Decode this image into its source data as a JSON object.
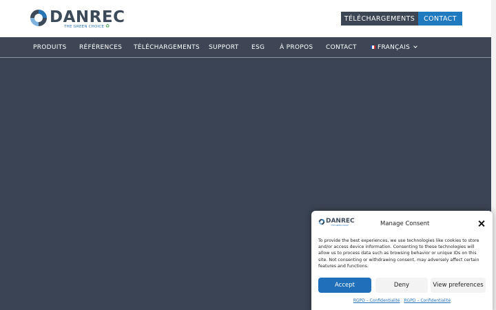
{
  "brand": {
    "name": "DANREC",
    "tagline": "THE GREEN CHOICE",
    "colors": {
      "dark": "#3c4a5a",
      "blue": "#1f7ac0",
      "green": "#3aa04a"
    }
  },
  "header": {
    "downloads_label": "TÉLÉCHARGEMENTS",
    "contact_label": "CONTACT"
  },
  "nav": {
    "items": [
      {
        "label": "PRODUITS"
      },
      {
        "label": "RÉFÉRENCES"
      },
      {
        "label": "TÉLÉCHARGEMENTS"
      },
      {
        "label": "SUPPORT"
      },
      {
        "label": "ESG"
      },
      {
        "label": "À PROPOS"
      },
      {
        "label": "CONTACT"
      }
    ],
    "language": {
      "label": "FRANÇAIS",
      "flag_icon": "french-flag-icon"
    }
  },
  "hero": {
    "background": "#3b4454"
  },
  "consent": {
    "title": "Manage Consent",
    "logo_text": "DANREC",
    "logo_tagline": "THE GREEN CHOICE",
    "body": "To provide the best experiences, we use technologies like cookies to store and/or access device information. Consenting to these technologies will allow us to process data such as browsing behavior or unique IDs on this site. Not consenting or withdrawing consent, may adversely affect certain features and functions.",
    "accept_label": "Accept",
    "deny_label": "Deny",
    "preferences_label": "View preferences",
    "links": [
      "RGPD – Confidentialité",
      "RGPD – Confidentialité"
    ]
  }
}
